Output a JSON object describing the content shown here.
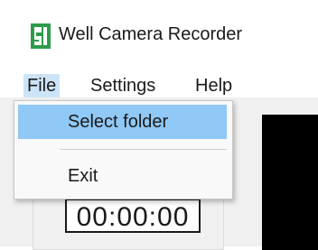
{
  "window": {
    "title": "Well Camera Recorder",
    "icon": "app-logo-icon",
    "accent_color": "#2e9b4a"
  },
  "menubar": {
    "items": [
      {
        "label": "File"
      },
      {
        "label": "Settings"
      },
      {
        "label": "Help"
      }
    ]
  },
  "file_menu": {
    "items": [
      {
        "label": "Select folder"
      },
      {
        "label": "Exit"
      }
    ],
    "hover_color": "#90c8f6"
  },
  "main": {
    "timer": "00:00:00",
    "video_background": "#000000"
  }
}
